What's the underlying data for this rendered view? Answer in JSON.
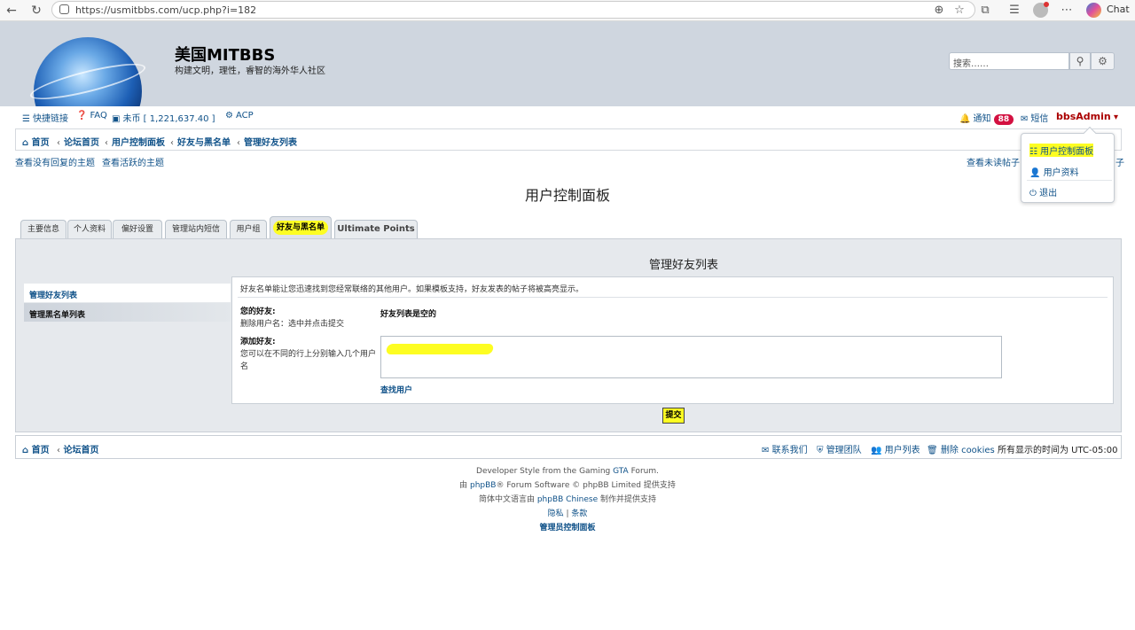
{
  "browser": {
    "url": "https://usmitbbs.com/ucp.php?i=182",
    "chat_label": "Chat"
  },
  "header": {
    "site_title": "美国MITBBS",
    "site_desc": "构建文明，理性，睿智的海外华人社区",
    "search_placeholder": "搜索……"
  },
  "navbar": {
    "quick_links": "快捷链接",
    "faq": "FAQ",
    "coins": "未币 [ 1,221,637.40 ]",
    "acp": "ACP",
    "notifications": "通知",
    "notifications_count": "88",
    "messages": "短信",
    "username": "bbsAdmin"
  },
  "breadcrumbs": [
    "首页",
    "论坛首页",
    "用户控制面板",
    "好友与黑名单",
    "管理好友列表"
  ],
  "quick": {
    "unanswered": "查看没有回复的主题",
    "active": "查看活跃的主题",
    "unread": "查看未读帖子",
    "new_posts_tail": "子"
  },
  "dropdown": {
    "items": [
      "用户控制面板",
      "用户资料",
      "退出"
    ]
  },
  "page_heading": "用户控制面板",
  "tabs": [
    "主要信息",
    "个人资料",
    "偏好设置",
    "管理站内短信",
    "用户组",
    "好友与黑名单",
    "Ultimate Points"
  ],
  "sidebar": {
    "items": [
      "管理好友列表",
      "管理黑名单列表"
    ]
  },
  "panel": {
    "title": "管理好友列表",
    "intro": "好友名单能让您迅速找到您经常联络的其他用户。如果模板支持，好友发表的帖子将被高亮显示。",
    "your_friends_label": "您的好友:",
    "your_friends_hint": "删除用户名：选中并点击提交",
    "friends_empty": "好友列表是空的",
    "add_friends_label": "添加好友:",
    "add_friends_hint": "您可以在不同的行上分别输入几个用户名",
    "find_user": "查找用户",
    "submit": "提交"
  },
  "footer_nav": {
    "home": "首页",
    "board_index": "论坛首页",
    "contact": "联系我们",
    "team": "管理团队",
    "members": "用户列表",
    "delete_cookies": "删除 cookies",
    "timezone": "所有显示的时间为 UTC-05:00"
  },
  "credits": {
    "line1_a": "Developer Style from the Gaming ",
    "line1_link": "GTA",
    "line1_b": " Forum.",
    "line2_a": "由 ",
    "line2_link": "phpBB",
    "line2_b": "® Forum Software © phpBB Limited 提供支持",
    "line3_a": "简体中文语言由 ",
    "line3_link": "phpBB Chinese",
    "line3_b": " 制作并提供支持",
    "privacy": "隐私",
    "terms": "条款",
    "acp_link": "管理员控制面板"
  },
  "colors": {
    "link": "#105289",
    "header_bg": "#cfd6df",
    "highlight": "#fdfd22",
    "badge": "#d31141",
    "username": "#aa0000"
  }
}
